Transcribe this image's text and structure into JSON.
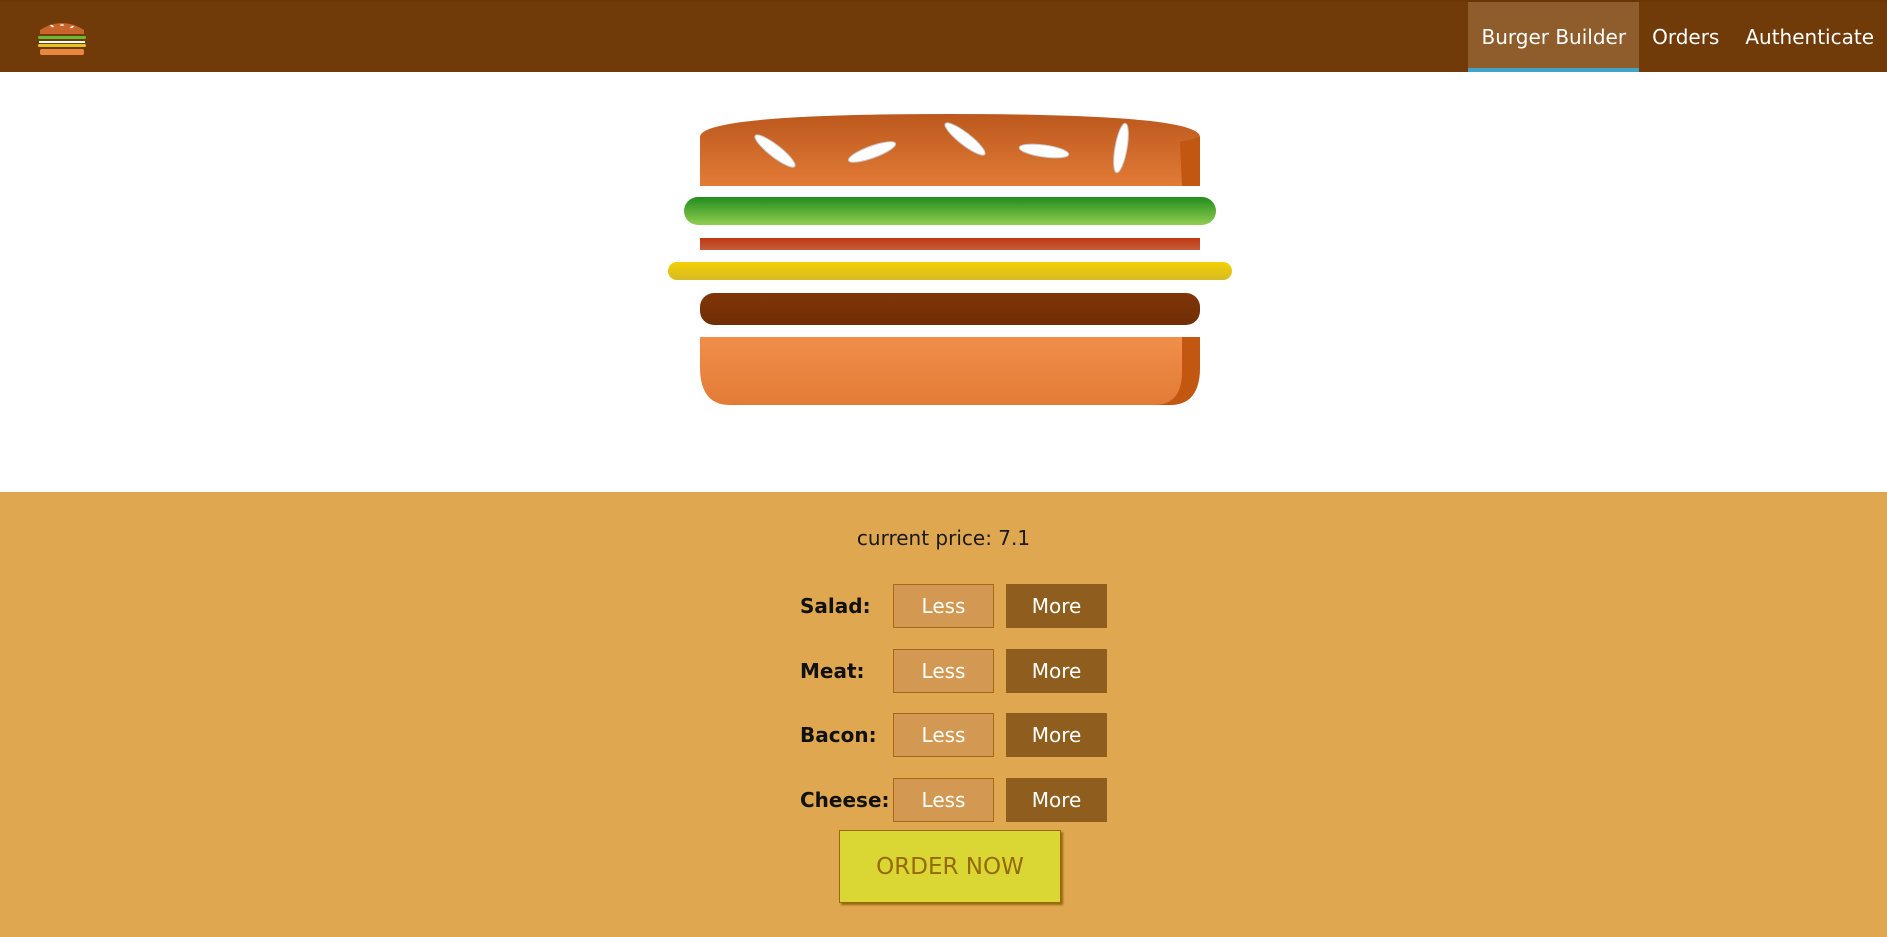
{
  "nav": {
    "items": [
      {
        "label": "Burger Builder",
        "active": true
      },
      {
        "label": "Orders",
        "active": false
      },
      {
        "label": "Authenticate",
        "active": false
      }
    ]
  },
  "logo": {
    "icon": "burger-logo-icon"
  },
  "burger": {
    "layers": [
      "bread-top",
      "salad",
      "bacon",
      "cheese",
      "meat",
      "bread-bottom"
    ]
  },
  "controls": {
    "price_text": "current price: 7.1",
    "ingredients": [
      {
        "label": "Salad:",
        "less": "Less",
        "more": "More"
      },
      {
        "label": "Meat:",
        "less": "Less",
        "more": "More"
      },
      {
        "label": "Bacon:",
        "less": "Less",
        "more": "More"
      },
      {
        "label": "Cheese:",
        "less": "Less",
        "more": "More"
      }
    ],
    "order_button": "ORDER NOW"
  },
  "colors": {
    "toolbar": "#703b09",
    "nav_active_bg": "#8f5c2c",
    "nav_active_underline": "#40a4c8",
    "controls_bg": "#e0a751",
    "less_button": "#d39952",
    "more_button": "#8f5e1e",
    "order_button": "#dad735"
  }
}
